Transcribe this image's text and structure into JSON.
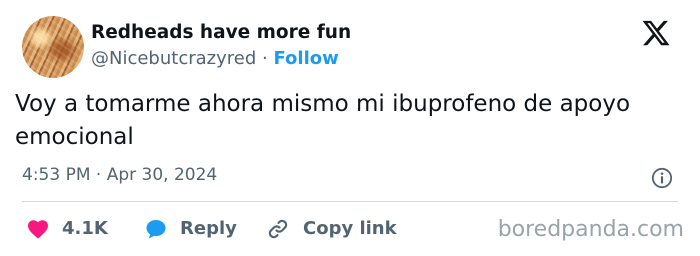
{
  "account": {
    "display_name": "Redheads have more fun",
    "handle": "@Nicebutcrazyred",
    "separator": "·",
    "follow_label": "Follow"
  },
  "brand": {
    "logo_icon": "x-logo-icon"
  },
  "tweet": {
    "text": "Voy a tomarme ahora mismo mi ibuprofeno de apoyo emocional",
    "timestamp": "4:53 PM · Apr 30, 2024"
  },
  "actions": {
    "likes_count": "4.1K",
    "reply_label": "Reply",
    "copy_link_label": "Copy link"
  },
  "watermark": "boredpanda.com",
  "colors": {
    "accent": "#1d9bf0",
    "like": "#f91880",
    "text": "#0f1419",
    "muted": "#536471"
  }
}
